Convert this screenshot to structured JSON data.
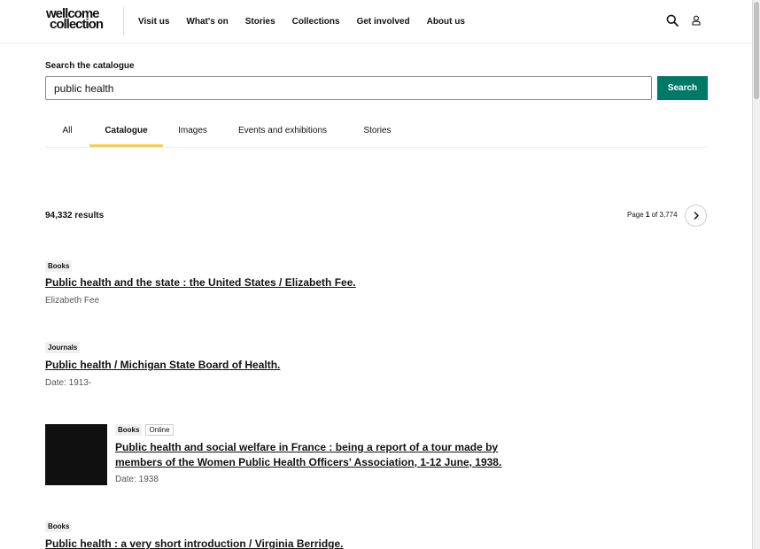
{
  "header": {
    "logo_line1": "wellcome",
    "logo_line2": "collection",
    "nav": [
      "Visit us",
      "What's on",
      "Stories",
      "Collections",
      "Get involved",
      "About us"
    ]
  },
  "search": {
    "label": "Search the catalogue",
    "value": "public health",
    "button_label": "Search"
  },
  "tabs": [
    "All",
    "Catalogue",
    "Images",
    "Events and exhibitions",
    "Stories"
  ],
  "active_tab": "Catalogue",
  "results": {
    "count_label": "94,332 results",
    "page_prefix": "Page",
    "page_current": "1",
    "page_of": "of 3,774"
  },
  "items": [
    {
      "badges": [
        "Books"
      ],
      "title": "Public health and the state : the United States / Elizabeth Fee.",
      "meta": "Elizabeth Fee"
    },
    {
      "badges": [
        "Journals"
      ],
      "title": "Public health / Michigan State Board of Health.",
      "meta": "Date: 1913-"
    },
    {
      "badges": [
        "Books",
        "Online"
      ],
      "title_line1": "Public health and social welfare in France : being a report of a tour made by",
      "title_line2": "members of the Women Public Health Officers' Association, 1-12 June, 1938.",
      "meta": "Date: 1938"
    },
    {
      "badges": [
        "Books"
      ],
      "title": "Public health : a very short introduction / Virginia Berridge."
    }
  ]
}
